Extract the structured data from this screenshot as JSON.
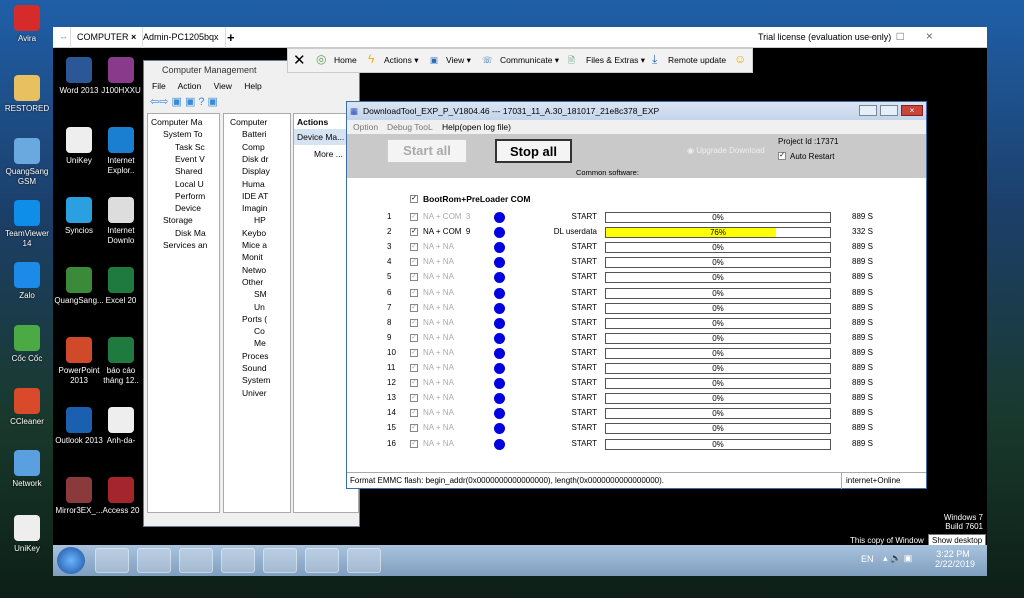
{
  "outer_desktop": {
    "icons": [
      "Avira",
      "RESTORED",
      "QuangSang GSM",
      "TeamViewer 14",
      "Zalo",
      "Cốc Cốc",
      "CCleaner",
      "Network",
      "UniKey"
    ]
  },
  "teamviewer": {
    "tabs": [
      "COMPUTER",
      "Admin-PC1205bqx"
    ],
    "license": "Trial license (evaluation use only)",
    "toolbar": [
      "Home",
      "Actions ▾",
      "View ▾",
      "Communicate ▾",
      "Files & Extras ▾",
      "Remote update"
    ]
  },
  "remote_desktop": {
    "icons": [
      "Word 2013",
      "J100HXXU",
      "UniKey",
      "Internet Explor..",
      "Syncios",
      "Internet Downlo",
      "QuangSang...",
      "Excel 20",
      "PowerPoint 2013",
      "báo cáo tháng 12..",
      "Outlook 2013",
      "Anh-da-",
      "Mirror3EX_...",
      "Access 20"
    ],
    "watermark": [
      "Windows 7",
      "Build 7601",
      "This copy of Window"
    ],
    "tooltip": "Show desktop",
    "tray": {
      "lang": "EN",
      "time": "3:22 PM",
      "date": "2/22/2019"
    }
  },
  "computer_management": {
    "title": "Computer Management",
    "menu": [
      "File",
      "Action",
      "View",
      "Help"
    ],
    "left_tree": [
      "Computer Ma",
      "System To",
      "Task Sc",
      "Event V",
      "Shared",
      "Local U",
      "Perform",
      "Device",
      "Storage",
      "Disk Ma",
      "Services an"
    ],
    "device_tree": [
      "Computer",
      "Batteri",
      "Comp",
      "Disk dr",
      "Display",
      "Huma",
      "IDE AT",
      "Imagin",
      "HP",
      "Keybo",
      "Mice a",
      "Monit",
      "Netwo",
      "Other",
      "SM",
      "Un",
      "Ports (",
      "Co",
      "Me",
      "Proces",
      "Sound",
      "System",
      "Univer"
    ],
    "actions": {
      "header": "Actions",
      "item": "Device Ma...",
      "more": "More ..."
    }
  },
  "download_tool": {
    "title": "DownloadTool_EXP_P_V1804.46 --- 17031_11_A.30_181017_21e8c378_EXP",
    "menu": [
      "Option",
      "Debug TooL",
      "Help(open log file)"
    ],
    "start_all": "Start all",
    "stop_all": "Stop all",
    "upgrade": "Upgrade Download",
    "project_id": "Project Id :17371",
    "auto_restart": "Auto Restart",
    "common": "Common software:",
    "bootrom": "BootRom+PreLoader COM",
    "rows": [
      {
        "n": "1",
        "port": "NA + COM  3",
        "status": "START",
        "pct": 0,
        "pct_label": "0%",
        "time": "889 S",
        "enabled": false
      },
      {
        "n": "2",
        "port": "NA + COM  9",
        "status": "DL userdata",
        "pct": 76,
        "pct_label": "76%",
        "time": "332 S",
        "enabled": true
      },
      {
        "n": "3",
        "port": "NA + NA",
        "status": "START",
        "pct": 0,
        "pct_label": "0%",
        "time": "889 S",
        "enabled": false
      },
      {
        "n": "4",
        "port": "NA + NA",
        "status": "START",
        "pct": 0,
        "pct_label": "0%",
        "time": "889 S",
        "enabled": false
      },
      {
        "n": "5",
        "port": "NA + NA",
        "status": "START",
        "pct": 0,
        "pct_label": "0%",
        "time": "889 S",
        "enabled": false
      },
      {
        "n": "6",
        "port": "NA + NA",
        "status": "START",
        "pct": 0,
        "pct_label": "0%",
        "time": "889 S",
        "enabled": false
      },
      {
        "n": "7",
        "port": "NA + NA",
        "status": "START",
        "pct": 0,
        "pct_label": "0%",
        "time": "889 S",
        "enabled": false
      },
      {
        "n": "8",
        "port": "NA + NA",
        "status": "START",
        "pct": 0,
        "pct_label": "0%",
        "time": "889 S",
        "enabled": false
      },
      {
        "n": "9",
        "port": "NA + NA",
        "status": "START",
        "pct": 0,
        "pct_label": "0%",
        "time": "889 S",
        "enabled": false
      },
      {
        "n": "10",
        "port": "NA + NA",
        "status": "START",
        "pct": 0,
        "pct_label": "0%",
        "time": "889 S",
        "enabled": false
      },
      {
        "n": "11",
        "port": "NA + NA",
        "status": "START",
        "pct": 0,
        "pct_label": "0%",
        "time": "889 S",
        "enabled": false
      },
      {
        "n": "12",
        "port": "NA + NA",
        "status": "START",
        "pct": 0,
        "pct_label": "0%",
        "time": "889 S",
        "enabled": false
      },
      {
        "n": "13",
        "port": "NA + NA",
        "status": "START",
        "pct": 0,
        "pct_label": "0%",
        "time": "889 S",
        "enabled": false
      },
      {
        "n": "14",
        "port": "NA + NA",
        "status": "START",
        "pct": 0,
        "pct_label": "0%",
        "time": "889 S",
        "enabled": false
      },
      {
        "n": "15",
        "port": "NA + NA",
        "status": "START",
        "pct": 0,
        "pct_label": "0%",
        "time": "889 S",
        "enabled": false
      },
      {
        "n": "16",
        "port": "NA + NA",
        "status": "START",
        "pct": 0,
        "pct_label": "0%",
        "time": "889 S",
        "enabled": false
      }
    ],
    "status_msg": "Format EMMC flash:  begin_addr(0x0000000000000000), length(0x0000000000000000).",
    "status_net": "internet+Online",
    "colors": {
      "progress": "#ffff00",
      "dot": "#0000e0"
    }
  }
}
